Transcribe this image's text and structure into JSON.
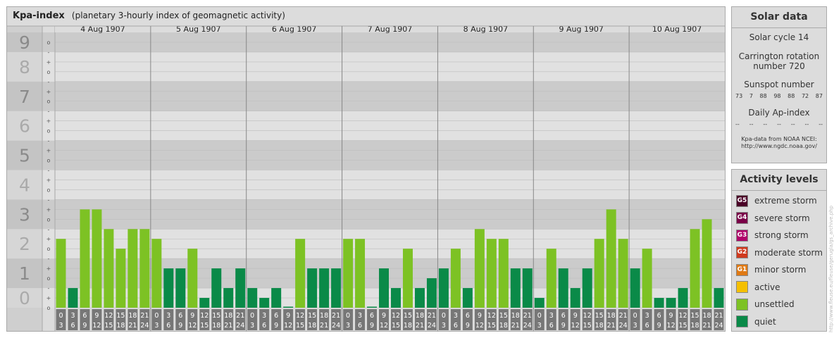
{
  "header": {
    "title": "Kpa-index",
    "subtitle": "(planetary 3-hourly index of geomagnetic activity)"
  },
  "chart_data": {
    "type": "bar",
    "title": "Kpa-index",
    "subtitle": "(planetary 3-hourly index of geomagnetic activity)",
    "ylim": [
      0,
      9
    ],
    "y_ticks": [
      "0",
      "1",
      "2",
      "3",
      "4",
      "5",
      "6",
      "7",
      "8",
      "9"
    ],
    "y_minor_marks": [
      "-",
      "o",
      "+"
    ],
    "days": [
      "4 Aug 1907",
      "5 Aug 1907",
      "6 Aug 1907",
      "7 Aug 1907",
      "8 Aug 1907",
      "9 Aug 1907",
      "10 Aug 1907"
    ],
    "interval_labels": [
      [
        "0",
        "3"
      ],
      [
        "3",
        "6"
      ],
      [
        "6",
        "9"
      ],
      [
        "9",
        "12"
      ],
      [
        "12",
        "15"
      ],
      [
        "15",
        "18"
      ],
      [
        "18",
        "21"
      ],
      [
        "21",
        "24"
      ]
    ],
    "values": [
      [
        2.333,
        0.667,
        3.333,
        3.333,
        2.667,
        2.0,
        2.667,
        2.667
      ],
      [
        2.333,
        1.333,
        1.333,
        2.0,
        0.333,
        1.333,
        0.667,
        1.333
      ],
      [
        0.667,
        0.333,
        0.667,
        0.0,
        2.333,
        1.333,
        1.333,
        1.333
      ],
      [
        2.333,
        2.333,
        0.0,
        1.333,
        0.667,
        2.0,
        0.667,
        1.0
      ],
      [
        1.333,
        2.0,
        0.667,
        2.667,
        2.333,
        2.333,
        1.333,
        1.333
      ],
      [
        0.333,
        2.0,
        1.333,
        0.667,
        1.333,
        2.333,
        3.333,
        2.333
      ],
      [
        1.333,
        2.0,
        0.333,
        0.333,
        0.667,
        2.667,
        3.0,
        0.667
      ]
    ],
    "grid": true
  },
  "solar": {
    "title": "Solar data",
    "cycle": "Solar cycle 14",
    "carrington_line1": "Carrington rotation",
    "carrington_line2": "number 720",
    "sunspot_title": "Sunspot number",
    "sunspots": [
      "73",
      "7",
      "88",
      "98",
      "88",
      "72",
      "87"
    ],
    "ap_title": "Daily Ap-index",
    "ap_values": [
      "--",
      "--",
      "--",
      "--",
      "--",
      "--",
      "--"
    ],
    "credit_line1": "Kpa-data from NOAA NCEI:",
    "credit_line2": "http://www.ngdc.noaa.gov/"
  },
  "levels": {
    "title": "Activity levels",
    "items": [
      {
        "code": "G5",
        "label": "extreme storm",
        "color": "#4a0026"
      },
      {
        "code": "G4",
        "label": "severe storm",
        "color": "#7a0048"
      },
      {
        "code": "G3",
        "label": "strong storm",
        "color": "#b0006a"
      },
      {
        "code": "G2",
        "label": "moderate storm",
        "color": "#d03a1e"
      },
      {
        "code": "G1",
        "label": "minor storm",
        "color": "#e07a14"
      },
      {
        "code": "",
        "label": "active",
        "color": "#f5c000"
      },
      {
        "code": "",
        "label": "unsettled",
        "color": "#7dc224"
      },
      {
        "code": "",
        "label": "quiet",
        "color": "#0a8a48"
      }
    ]
  },
  "colors": {
    "quiet": "#0a8a48",
    "unsettled": "#7dc224",
    "panel": "#dcdcdc",
    "band_dark": "#cbcbcb",
    "band_light": "#e1e1e1",
    "axis_box": "#777777"
  },
  "side_credit": "http://www.fleuse.eu/fleuse/gerugla/gs_archive.php"
}
